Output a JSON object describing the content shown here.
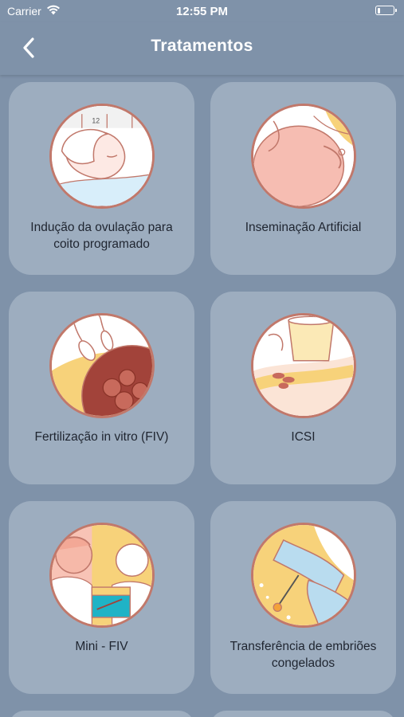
{
  "status_bar": {
    "carrier": "Carrier",
    "time": "12:55 PM",
    "battery_level": 0.2
  },
  "nav": {
    "title": "Tratamentos",
    "back_icon": "chevron-left-icon"
  },
  "treatments": [
    {
      "label": "Indução da ovulação para coito programado",
      "illustration": "woman-calendar"
    },
    {
      "label": "Inseminação Artificial",
      "illustration": "sperm-close-up"
    },
    {
      "label": "Fertilização in vitro (FIV)",
      "illustration": "sperm-egg"
    },
    {
      "label": "ICSI",
      "illustration": "lab-dish"
    },
    {
      "label": "Mini - FIV",
      "illustration": "couple-doctor"
    },
    {
      "label": "Transferência de embriões congelados",
      "illustration": "gloved-hands-pipette"
    }
  ],
  "colors": {
    "background": "#7f92a9",
    "card": "#9dadbf",
    "ring": "#c1786b",
    "text": "#1f2530",
    "accent_yellow": "#f7d27a"
  }
}
